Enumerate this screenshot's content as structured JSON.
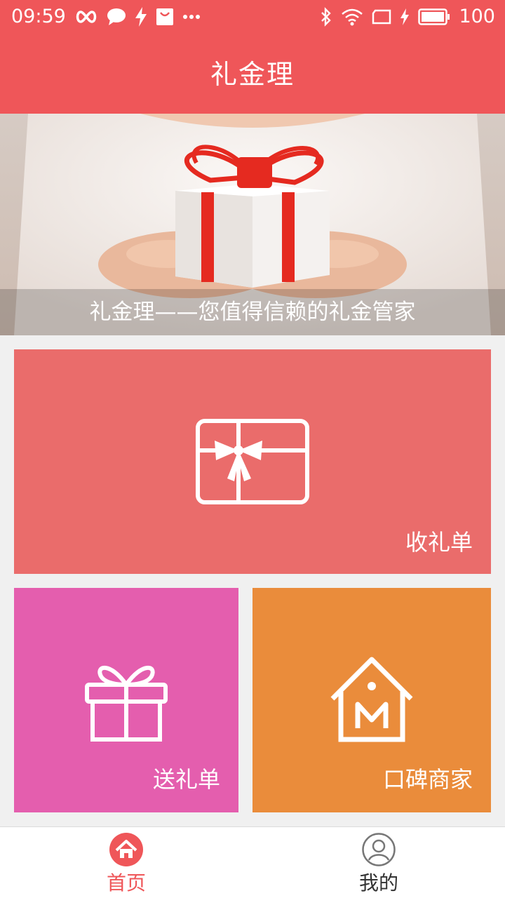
{
  "status_bar": {
    "time": "09:59",
    "battery": "100",
    "icons": [
      "infinity-icon",
      "chat-icon",
      "flash-icon",
      "bag-icon",
      "more-icon",
      "bluetooth-icon",
      "wifi-icon",
      "screen-icon",
      "charging-icon",
      "battery-icon"
    ]
  },
  "app_bar": {
    "title": "礼金理"
  },
  "banner": {
    "caption": "礼金理——您值得信赖的礼金管家"
  },
  "tiles": {
    "receive": {
      "label": "收礼单",
      "color": "#ea6c6b",
      "icon": "gift-card-icon"
    },
    "send": {
      "label": "送礼单",
      "color": "#e45eae",
      "icon": "gift-box-icon"
    },
    "shop": {
      "label": "口碑商家",
      "color": "#ea8c3b",
      "icon": "merchant-house-icon"
    }
  },
  "tab_bar": {
    "tabs": [
      {
        "label": "首页",
        "icon": "home-icon",
        "active": true
      },
      {
        "label": "我的",
        "icon": "user-icon",
        "active": false
      }
    ],
    "active_color": "#ef5659"
  },
  "colors": {
    "primary": "#ef5659"
  }
}
